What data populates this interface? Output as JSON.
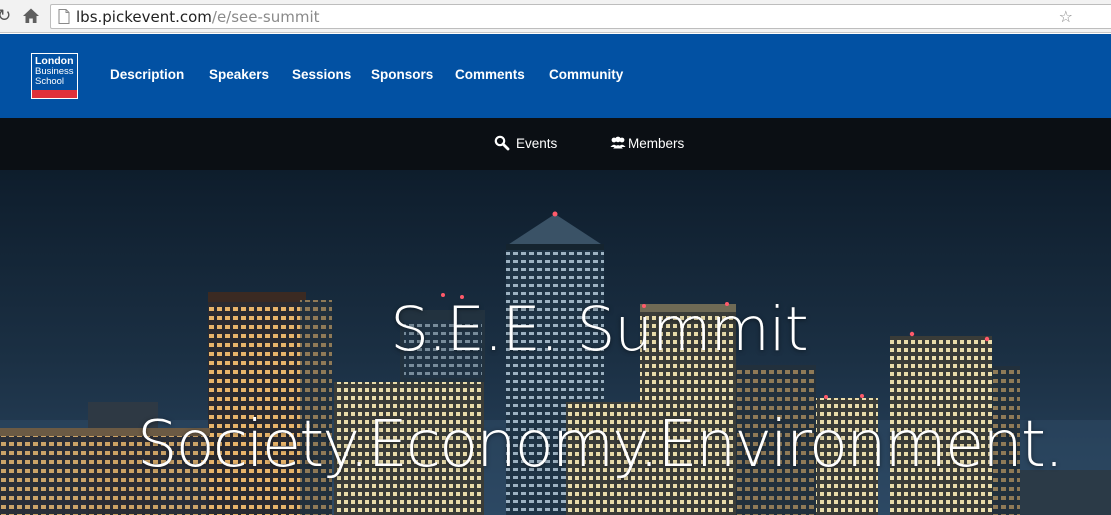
{
  "browser": {
    "url_host": "lbs.pickevent.com",
    "url_path": "/e/see-summit",
    "icons": [
      "reload-icon",
      "home-icon",
      "page-icon",
      "bookmark-star-icon"
    ]
  },
  "logo": {
    "line1": "London",
    "line2": "Business",
    "line3": "School"
  },
  "nav": {
    "items": [
      "Description",
      "Speakers",
      "Sessions",
      "Sponsors",
      "Comments",
      "Community"
    ]
  },
  "subnav": {
    "events": "Events",
    "members": "Members"
  },
  "hero": {
    "title": "S.E.E. Summit",
    "tagline": "Society.Economy.Environment."
  },
  "colors": {
    "brand_blue": "#0251a3",
    "logo_red": "#e0313b",
    "subbar": "#0b0f14",
    "sky_top": "#0e1d2c",
    "sky_bottom": "#2a4560"
  }
}
